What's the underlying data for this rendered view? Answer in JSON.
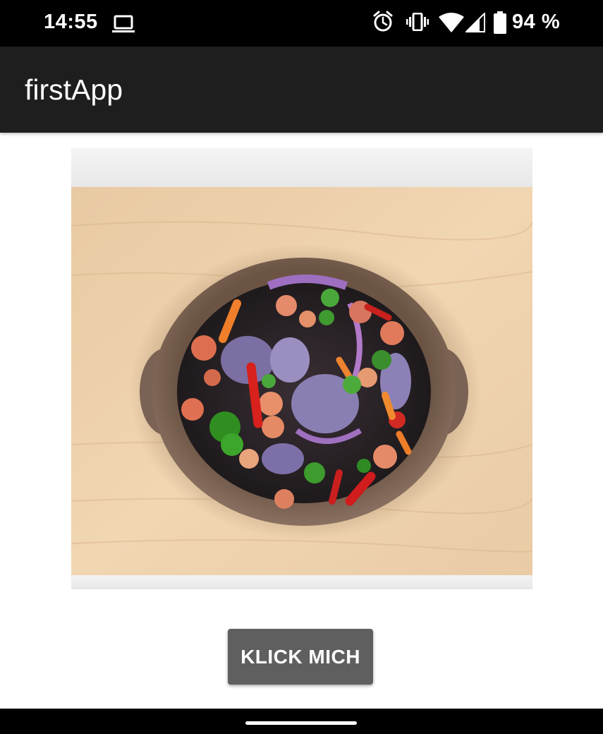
{
  "status_bar": {
    "time": "14:55",
    "battery": "94 %",
    "icons": [
      "laptop-icon",
      "alarm-icon",
      "vibrate-icon",
      "wifi-icon",
      "cell-signal-icon",
      "battery-icon"
    ]
  },
  "app_bar": {
    "title": "firstApp"
  },
  "main": {
    "image": "salad-bowl-photo",
    "button_label": "KLICK MICH"
  },
  "colors": {
    "status_bar": "#000000",
    "app_bar": "#1e1e1e",
    "button": "#5f5f5f",
    "background": "#ffffff"
  }
}
